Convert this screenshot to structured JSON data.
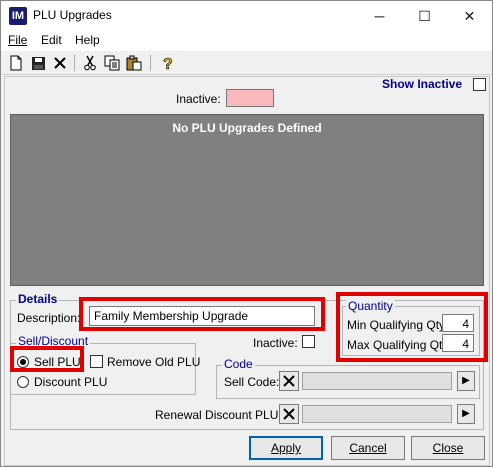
{
  "window": {
    "app_icon_text": "IM",
    "title": "PLU Upgrades",
    "controls": {
      "minimize": "─",
      "maximize": "☐",
      "close": "✕"
    }
  },
  "menu": [
    {
      "label": "File"
    },
    {
      "label": "Edit"
    },
    {
      "label": "Help"
    }
  ],
  "toolbar": {
    "icons": [
      "new-icon",
      "save-icon",
      "delete-icon",
      "cut-icon",
      "copy-icon",
      "paste-icon",
      "help-icon"
    ]
  },
  "top": {
    "show_inactive_label": "Show Inactive",
    "show_inactive_checked": false,
    "inactive_label": "Inactive:",
    "inactive_color": "#f9b9bd"
  },
  "grid": {
    "empty_message": "No PLU Upgrades Defined",
    "background": "#808080"
  },
  "details": {
    "group_title": "Details",
    "description_label": "Description:",
    "description_value": "Family Membership Upgrade",
    "inactive_label": "Inactive:",
    "inactive_checked": false
  },
  "quantity": {
    "group_title": "Quantity",
    "min_label": "Min Qualifying Qty:",
    "min_value": "4",
    "max_label": "Max Qualifying Qty:",
    "max_value": "4"
  },
  "sell_discount": {
    "group_title": "Sell/Discount",
    "sell_plu_label": "Sell PLU",
    "sell_plu_selected": true,
    "remove_old_plu_label": "Remove Old PLU",
    "remove_old_plu_checked": false,
    "discount_plu_label": "Discount PLU",
    "discount_plu_selected": false
  },
  "code": {
    "group_title": "Code",
    "sell_code_label": "Sell Code:",
    "sell_code_value": "",
    "renewal_label": "Renewal Discount PLU:",
    "renewal_value": ""
  },
  "buttons": {
    "apply": "Apply",
    "cancel": "Cancel",
    "close": "Close"
  },
  "colors": {
    "highlight": "#e00000",
    "title_blue": "#00008b"
  }
}
